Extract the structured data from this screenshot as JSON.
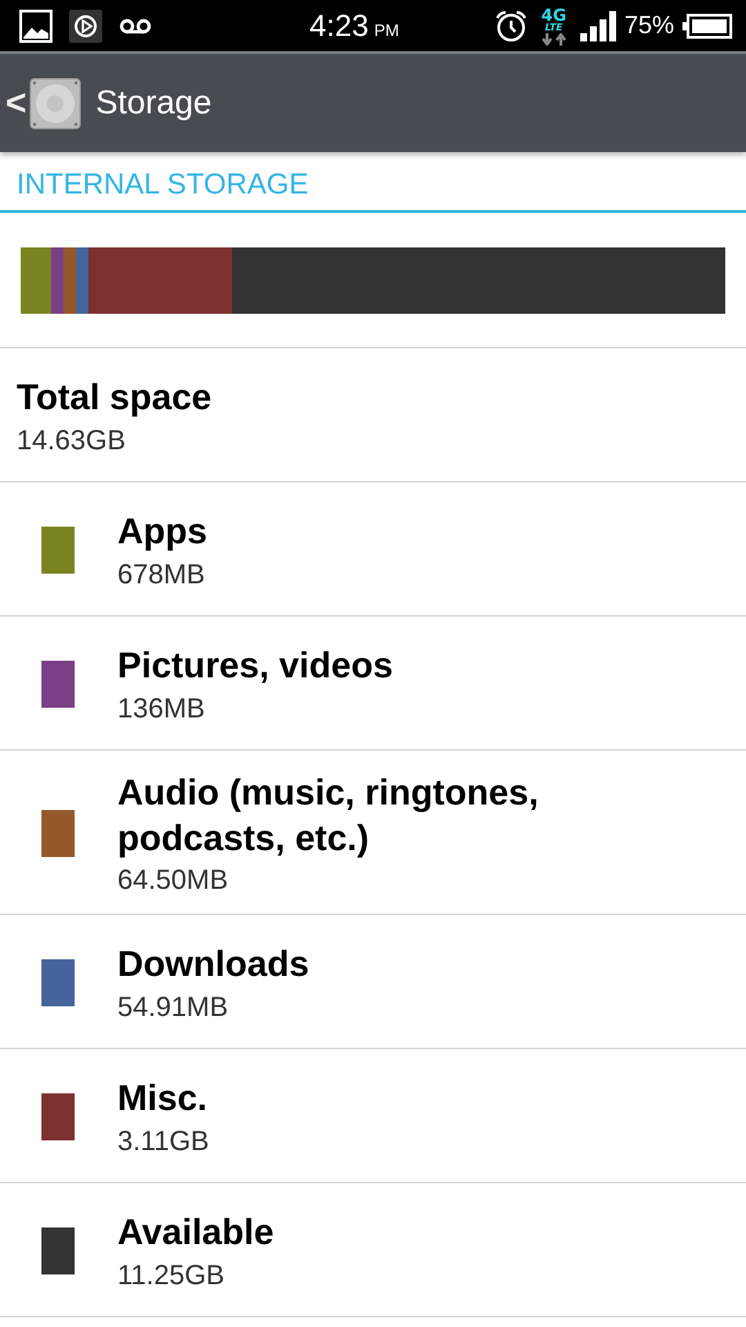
{
  "status_bar": {
    "time": "4:23",
    "ampm": "PM",
    "network": "4G",
    "network_sub": "LTE",
    "battery": "75%"
  },
  "action_bar": {
    "title": "Storage",
    "back": "<"
  },
  "section": {
    "title": "INTERNAL STORAGE"
  },
  "total": {
    "label": "Total space",
    "value": "14.63GB"
  },
  "categories": [
    {
      "name": "Apps",
      "size": "678MB",
      "color": "#7a8420"
    },
    {
      "name": "Pictures, videos",
      "size": "136MB",
      "color": "#7b3f86"
    },
    {
      "name": "Audio (music, ringtones, podcasts, etc.)",
      "size": "64.50MB",
      "color": "#93592a"
    },
    {
      "name": "Downloads",
      "size": "54.91MB",
      "color": "#47639b"
    },
    {
      "name": "Misc.",
      "size": "3.11GB",
      "color": "#7c3030"
    },
    {
      "name": "Available",
      "size": "11.25GB",
      "color": "#333333"
    }
  ]
}
